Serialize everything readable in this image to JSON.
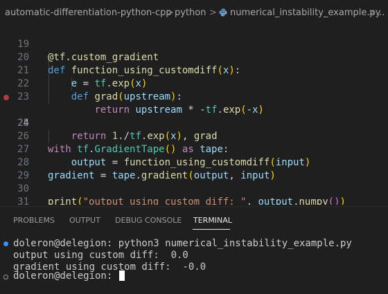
{
  "breadcrumb": {
    "folder": "automatic-differentiation-python-cpp",
    "subfolder": "python",
    "file": "numerical_instability_example.py",
    "more": "...",
    "separator": ">"
  },
  "editor": {
    "line_numbers": [
      "19",
      "20",
      "21",
      "22",
      "23",
      "24",
      "25",
      "26",
      "27",
      "28",
      "29",
      "30",
      "31"
    ],
    "active_line": "24",
    "breakpoint_line": "24"
  },
  "panel": {
    "tabs": [
      "PROBLEMS",
      "OUTPUT",
      "DEBUG CONSOLE",
      "TERMINAL"
    ],
    "active_tab": "TERMINAL"
  },
  "terminal": {
    "lines": [
      "doleron@delegion: python3 numerical_instability_example.py",
      "output using custom diff:  0.0",
      "gradient using custom diff:  -0.0",
      "doleron@delegion: "
    ]
  },
  "colors": {
    "background": "#1f1f1f",
    "keyword": "#c586c0",
    "storage": "#569cd6",
    "function": "#dcdcaa",
    "variable": "#9cdcfe",
    "class": "#4ec9b0",
    "string": "#ce9178",
    "breakpoint": "#b43b3b",
    "terminal_dot": "#3794ff"
  },
  "icons": [
    "python-file-icon",
    "breakpoint-icon",
    "terminal-command-dot-icon",
    "terminal-prompt-icon"
  ]
}
